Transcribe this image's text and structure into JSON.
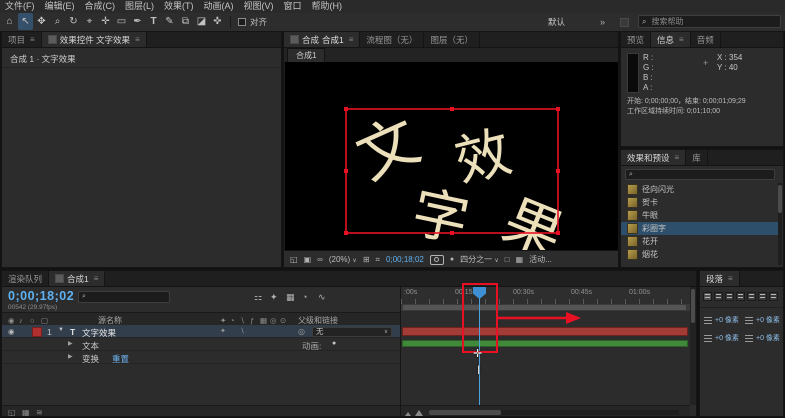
{
  "colors": {
    "accent_blue": "#3f8fd4",
    "timecode_blue": "#5fb2f2",
    "annotation_red": "#e81123",
    "comp_text_cream": "#ece0bb",
    "layer_bar_red": "#a33c36",
    "layer_bar_green": "#418a3c"
  },
  "menu": {
    "items": [
      "文件(F)",
      "编辑(E)",
      "合成(C)",
      "图层(L)",
      "效果(T)",
      "动画(A)",
      "视图(V)",
      "窗口",
      "帮助(H)"
    ]
  },
  "toolbar": {
    "tools": [
      {
        "name": "home",
        "glyph": "⌂"
      },
      {
        "name": "selection",
        "glyph": "↖"
      },
      {
        "name": "hand",
        "glyph": "✥"
      },
      {
        "name": "zoom",
        "glyph": "⌕"
      },
      {
        "name": "orbit-camera",
        "glyph": "↻"
      },
      {
        "name": "track-camera",
        "glyph": "⌖"
      },
      {
        "name": "pan-behind",
        "glyph": "✛"
      },
      {
        "name": "shape",
        "glyph": "▭"
      },
      {
        "name": "pen",
        "glyph": "✒"
      },
      {
        "name": "type",
        "glyph": "T"
      },
      {
        "name": "brush",
        "glyph": "✎"
      },
      {
        "name": "clone-stamp",
        "glyph": "⧉"
      },
      {
        "name": "eraser",
        "glyph": "◪"
      },
      {
        "name": "puppet",
        "glyph": "✜"
      }
    ],
    "snap_label": "对齐",
    "workspace_label": "默认",
    "overflow_glyph": "»",
    "search_placeholder": "搜索帮助"
  },
  "project_panel": {
    "tab_project": "项目",
    "tab_effect_controls": "效果控件 文字效果",
    "content_line": "合成 1 · 文字效果"
  },
  "viewer": {
    "tab_comp_prefix": "合成",
    "tab_comp_name": "合成1",
    "tab_flowchart": "流程图（无）",
    "tab_layer": "图层（无）",
    "subtab": "合成1",
    "comp_glyphs": [
      "文",
      "字",
      "效",
      "果"
    ],
    "strip_icons": [
      "◱",
      "▣",
      "∞",
      "⊞",
      "⌗",
      "□",
      "▦"
    ],
    "zoom_label": "(20%)",
    "timecode": "0;00;18;02",
    "resolution_label": "四分之一",
    "view_label": "活动..."
  },
  "info_panel": {
    "tab_preview": "预览",
    "tab_info": "信息",
    "tab_audio": "音频",
    "channels": [
      "R :",
      "G :",
      "B :",
      "A :"
    ],
    "coord_x": "X : 354",
    "coord_y": "Y : 40",
    "line1": "开始: 0;00;00;00，结束: 0;00;01;09;29",
    "line2": "工作区域持续时间: 0;01;10;00"
  },
  "effects_panel": {
    "tab_effects": "效果和预设",
    "tab_library": "库",
    "items": [
      {
        "name": "径向闪光"
      },
      {
        "name": "贺卡"
      },
      {
        "name": "牛眼"
      },
      {
        "name": "彩圈字"
      },
      {
        "name": "花开"
      },
      {
        "name": "烟花"
      }
    ]
  },
  "timeline": {
    "tab_render_queue": "渲染队列",
    "tab_comp": "合成1",
    "timecode": "0;00;18;02",
    "frame_info": "00542 (29.97fps)",
    "toolbar_icons": [
      "⚏",
      "✦",
      "▦",
      "◔",
      "∿"
    ],
    "col_source_name": "源名称",
    "col_parent": "父级和链接",
    "switch_header_icons": [
      "✦",
      "◔",
      "∖",
      "ƒ",
      "▦",
      "◎",
      "⊙"
    ],
    "row_switch_icons": [
      "✦",
      "∖"
    ],
    "footer_icons": [
      "◱",
      "▦",
      "≋"
    ],
    "layer": {
      "index": "1",
      "type_badge": "T",
      "name": "文字效果",
      "parent_value": "无"
    },
    "prop_text_label": "文本",
    "prop_text_animate": "动画:",
    "prop_transform_label": "变换",
    "prop_transform_reset": "重置",
    "ruler_labels": [
      ":00s",
      "00:15s",
      "00:30s",
      "00:45s",
      "01:00s"
    ]
  },
  "paragraph_panel": {
    "title": "段落",
    "fields": [
      {
        "value": "+0 像素"
      },
      {
        "value": "+0 像素"
      },
      {
        "value": "+0 像素"
      },
      {
        "value": "+0 像素"
      }
    ]
  },
  "icons": {
    "menu": "≡",
    "search": "⌕",
    "chevron": "∨",
    "twirl_open": "▼",
    "twirl_closed": "▶",
    "eye": "◉",
    "audio": "♪",
    "solo": "○",
    "lock": "▢",
    "pickwhip": "◎",
    "animate_add": "●",
    "crosshair": "+",
    "snapshot_dot": "●",
    "move_cursor": "✛",
    "ibeam_cursor": "I"
  }
}
